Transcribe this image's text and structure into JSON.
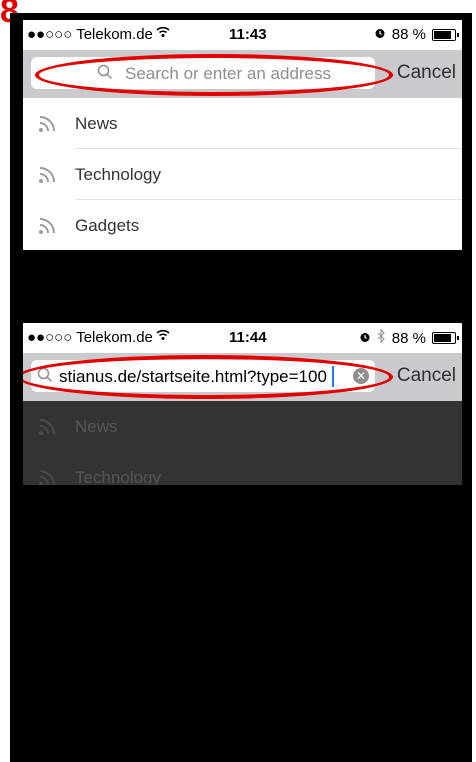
{
  "label": "8.",
  "screen1": {
    "status": {
      "carrier": "●●○○○ Telekom.de",
      "time": "11:43",
      "battery": "88 %"
    },
    "search": {
      "placeholder": "Search or enter an address",
      "cancel": "Cancel"
    },
    "items": [
      {
        "label": "News"
      },
      {
        "label": "Technology"
      },
      {
        "label": "Gadgets"
      }
    ]
  },
  "screen2": {
    "status": {
      "carrier": "●●○○○ Telekom.de",
      "time": "11:44",
      "battery": "88 %"
    },
    "search": {
      "value": "stianus.de/startseite.html?type=100",
      "cancel": "Cancel"
    },
    "items": [
      {
        "label": "News"
      },
      {
        "label": "Technology"
      }
    ]
  },
  "icons": {
    "wifi": "wifi-icon",
    "alarm": "alarm-icon",
    "bluetooth": "bluetooth-icon",
    "battery": "battery-icon",
    "search": "search-icon",
    "rss": "rss-icon",
    "clear": "clear-icon"
  },
  "colors": {
    "annotation": "#e30000",
    "cancel": "#2f2f33",
    "dimmed_overlay": "#333333"
  }
}
